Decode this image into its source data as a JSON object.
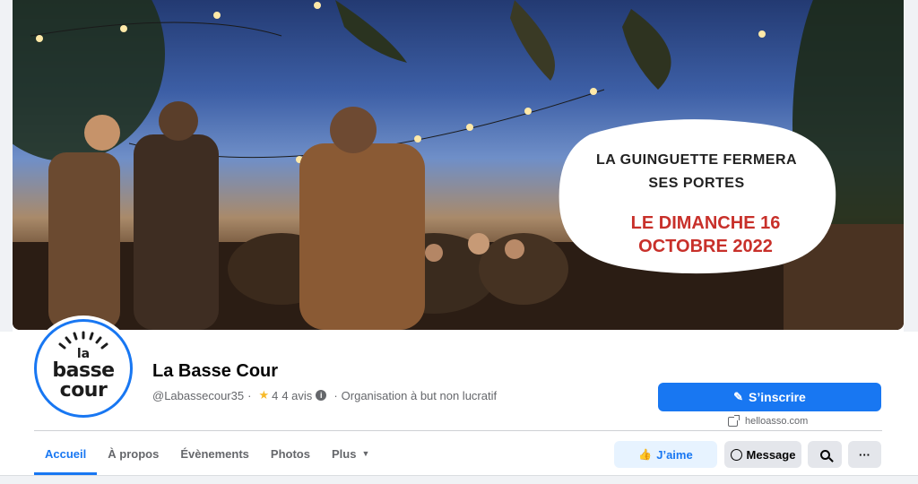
{
  "cover": {
    "line1": "LA GUINGUETTE FERMERA",
    "line2": "SES PORTES",
    "line3": "LE DIMANCHE 16",
    "line4": "OCTOBRE 2022"
  },
  "avatar": {
    "line1": "la",
    "line2": "basse",
    "line3": "cour"
  },
  "profile": {
    "name": "La Basse Cour",
    "handle": "@Labassecour35",
    "sep1": "·",
    "rating": "4",
    "reviews": "4 avis",
    "sep2": "·",
    "category": "Organisation à but non lucratif"
  },
  "actions": {
    "subscribe_label": "S’inscrire",
    "link_text": "helloasso.com",
    "like_label": "J’aime",
    "message_label": "Message",
    "more_label": "···"
  },
  "tabs": [
    {
      "label": "Accueil"
    },
    {
      "label": "À propos"
    },
    {
      "label": "Évènements"
    },
    {
      "label": "Photos"
    },
    {
      "label": "Plus"
    }
  ],
  "colors": {
    "accent": "#1877f2",
    "headline_red": "#c8302a"
  }
}
